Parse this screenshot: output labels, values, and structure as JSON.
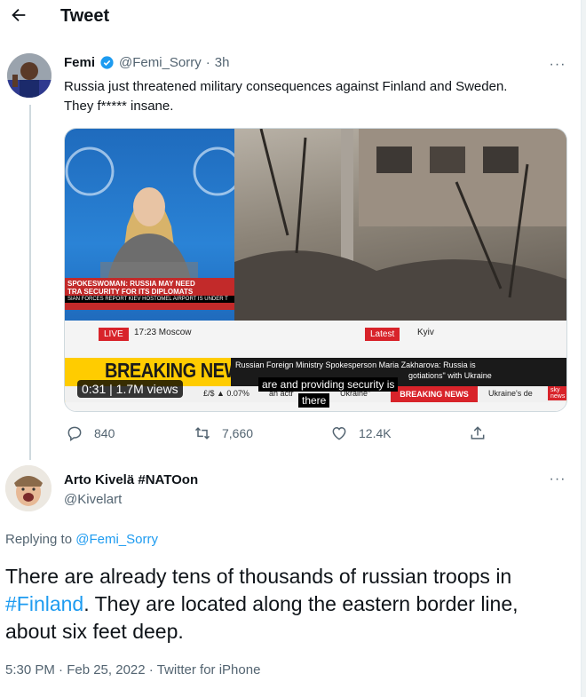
{
  "header": {
    "title": "Tweet",
    "back_icon": "arrow-left-icon"
  },
  "tweet": {
    "author_name": "Femi",
    "handle": "@Femi_Sorry",
    "separator": "·",
    "time": "3h",
    "text_line1": "Russia just threatened military consequences against Finland and Sweden.",
    "text_line2": "They f***** insane.",
    "more_icon": "···",
    "media": {
      "views_badge": "0:31 | 1.7M views",
      "live_label": "LIVE",
      "live_time": "17:23 Moscow",
      "latest_label": "Latest",
      "latest_place": "Kyiv",
      "breaking_news": "BREAKING NEWS",
      "headline": "Russian Foreign Ministry Spokesperson Maria Zakharova: Russia is",
      "headline_tail": "gotiations\" with Ukraine",
      "subtitle_line1": "are and providing security is",
      "subtitle_line2": "there",
      "ticker_fx": "£/$ ▲ 0.07%",
      "ticker_mid": "an actr",
      "ticker_ukraine": "Ukraine\"",
      "ticker_bn": "BREAKING NEWS",
      "ticker_tail": "Ukraine's de",
      "sky_logo": "sky news",
      "left_caption1": "SPOKESWOMAN: RUSSIA MAY NEED",
      "left_caption2": "TRA SECURITY FOR ITS DIPLOMATS",
      "left_caption3": "SIAN FORCES REPORT KIEV HOSTOMEL AIRPORT IS UNDER T"
    },
    "actions": {
      "replies": "840",
      "retweets": "7,660",
      "likes": "12.4K"
    }
  },
  "reply": {
    "author_name": "Arto Kivelä #NATOon",
    "handle": "@Kivelart",
    "replying_prefix": "Replying to",
    "replying_to": "@Femi_Sorry",
    "text_part1": "There are already tens of thousands of russian troops in ",
    "hashtag": "#Finland",
    "text_part2": ". They are located along the eastern border line, about six feet deep.",
    "timestamp": "5:30 PM · Feb 25, 2022",
    "source_sep": "·",
    "source": "Twitter for iPhone",
    "more_icon": "···"
  },
  "colors": {
    "accent": "#1d9bf0",
    "text_secondary": "#536471",
    "breaking_yellow": "#ffcc00",
    "sky_red": "#d8232a"
  }
}
